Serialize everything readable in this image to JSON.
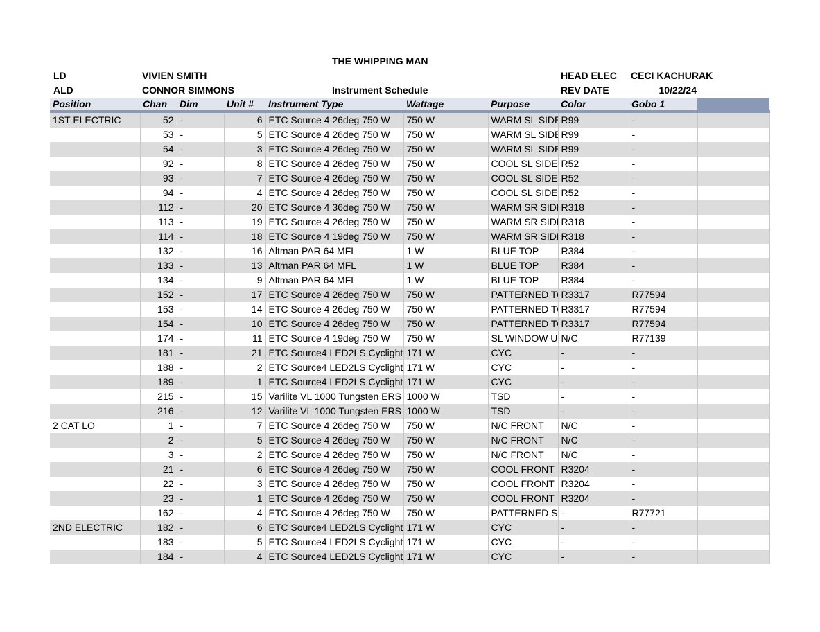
{
  "header": {
    "show_title": "THE WHIPPING MAN",
    "ld_label": "LD",
    "ld_name": "VIVIEN SMITH",
    "ald_label": "ALD",
    "ald_name": "CONNOR SIMMONS",
    "report_title": "Instrument Schedule",
    "head_elec_label": "HEAD ELEC",
    "head_elec_name": "CECI KACHURAK",
    "rev_date_label": "REV DATE",
    "rev_date": "10/22/24"
  },
  "table": {
    "columns": [
      "Position",
      "Chan",
      "Dim",
      "Unit #",
      "Instrument Type",
      "Wattage",
      "Purpose",
      "Color",
      "Gobo 1",
      ""
    ],
    "rows": [
      [
        "1ST ELECTRIC",
        "52",
        "-",
        "6",
        "ETC Source 4 26deg 750 W",
        "750 W",
        "WARM SL SIDE",
        "R99",
        "-",
        ""
      ],
      [
        "",
        "53",
        "-",
        "5",
        "ETC Source 4 26deg 750 W",
        "750 W",
        "WARM SL SIDE",
        "R99",
        "-",
        ""
      ],
      [
        "",
        "54",
        "-",
        "3",
        "ETC Source 4 26deg 750 W",
        "750 W",
        "WARM SL SIDE",
        "R99",
        "-",
        ""
      ],
      [
        "",
        "92",
        "-",
        "8",
        "ETC Source 4 26deg 750 W",
        "750 W",
        "COOL SL SIDE",
        "R52",
        "-",
        ""
      ],
      [
        "",
        "93",
        "-",
        "7",
        "ETC Source 4 26deg 750 W",
        "750 W",
        "COOL SL SIDE",
        "R52",
        "-",
        ""
      ],
      [
        "",
        "94",
        "-",
        "4",
        "ETC Source 4 26deg 750 W",
        "750 W",
        "COOL SL SIDE",
        "R52",
        "-",
        ""
      ],
      [
        "",
        "112",
        "-",
        "20",
        "ETC Source 4 36deg 750 W",
        "750 W",
        "WARM SR SIDE",
        "R318",
        "-",
        ""
      ],
      [
        "",
        "113",
        "-",
        "19",
        "ETC Source 4 26deg 750 W",
        "750 W",
        "WARM SR SIDE",
        "R318",
        "-",
        ""
      ],
      [
        "",
        "114",
        "-",
        "18",
        "ETC Source 4 19deg 750 W",
        "750 W",
        "WARM SR SIDE",
        "R318",
        "-",
        ""
      ],
      [
        "",
        "132",
        "-",
        "16",
        "Altman PAR 64 MFL",
        "1 W",
        "BLUE TOP",
        "R384",
        "-",
        ""
      ],
      [
        "",
        "133",
        "-",
        "13",
        "Altman PAR 64 MFL",
        "1 W",
        "BLUE TOP",
        "R384",
        "-",
        ""
      ],
      [
        "",
        "134",
        "-",
        "9",
        "Altman PAR 64 MFL",
        "1 W",
        "BLUE TOP",
        "R384",
        "-",
        ""
      ],
      [
        "",
        "152",
        "-",
        "17",
        "ETC Source 4 26deg 750 W",
        "750 W",
        "PATTERNED TO",
        "R3317",
        "R77594",
        ""
      ],
      [
        "",
        "153",
        "-",
        "14",
        "ETC Source 4 26deg 750 W",
        "750 W",
        "PATTERNED TO",
        "R3317",
        "R77594",
        ""
      ],
      [
        "",
        "154",
        "-",
        "10",
        "ETC Source 4 26deg 750 W",
        "750 W",
        "PATTERNED TO",
        "R3317",
        "R77594",
        ""
      ],
      [
        "",
        "174",
        "-",
        "11",
        "ETC Source 4 19deg 750 W",
        "750 W",
        "SL WINDOW US",
        "N/C",
        "R77139",
        ""
      ],
      [
        "",
        "181",
        "-",
        "21",
        "ETC Source4 LED2LS Cyclight",
        "171 W",
        "CYC",
        "-",
        "-",
        ""
      ],
      [
        "",
        "188",
        "-",
        "2",
        "ETC Source4 LED2LS Cyclight",
        "171 W",
        "CYC",
        "-",
        "-",
        ""
      ],
      [
        "",
        "189",
        "-",
        "1",
        "ETC Source4 LED2LS Cyclight",
        "171 W",
        "CYC",
        "-",
        "-",
        ""
      ],
      [
        "",
        "215",
        "-",
        "15",
        "Varilite VL 1000 Tungsten ERS",
        "1000 W",
        "TSD",
        "-",
        "-",
        ""
      ],
      [
        "",
        "216",
        "-",
        "12",
        "Varilite VL 1000 Tungsten ERS",
        "1000 W",
        "TSD",
        "-",
        "-",
        ""
      ],
      [
        "2 CAT LO",
        "1",
        "-",
        "7",
        "ETC Source 4 26deg 750 W",
        "750 W",
        "N/C FRONT",
        "N/C",
        "-",
        ""
      ],
      [
        "",
        "2",
        "-",
        "5",
        "ETC Source 4 26deg 750 W",
        "750 W",
        "N/C FRONT",
        "N/C",
        "-",
        ""
      ],
      [
        "",
        "3",
        "-",
        "2",
        "ETC Source 4 26deg 750 W",
        "750 W",
        "N/C FRONT",
        "N/C",
        "-",
        ""
      ],
      [
        "",
        "21",
        "-",
        "6",
        "ETC Source 4 26deg 750 W",
        "750 W",
        "COOL FRONT",
        "R3204",
        "-",
        ""
      ],
      [
        "",
        "22",
        "-",
        "3",
        "ETC Source 4 26deg 750 W",
        "750 W",
        "COOL FRONT",
        "R3204",
        "-",
        ""
      ],
      [
        "",
        "23",
        "-",
        "1",
        "ETC Source 4 26deg 750 W",
        "750 W",
        "COOL FRONT",
        "R3204",
        "-",
        ""
      ],
      [
        "",
        "162",
        "-",
        "4",
        "ETC Source 4 26deg 750 W",
        "750 W",
        "PATTERNED SC",
        "-",
        "R77721",
        ""
      ],
      [
        "2ND ELECTRIC",
        "182",
        "-",
        "6",
        "ETC Source4 LED2LS Cyclight",
        "171 W",
        "CYC",
        "-",
        "-",
        ""
      ],
      [
        "",
        "183",
        "-",
        "5",
        "ETC Source4 LED2LS Cyclight",
        "171 W",
        "CYC",
        "-",
        "-",
        ""
      ],
      [
        "",
        "184",
        "-",
        "4",
        "ETC Source4 LED2LS Cyclight",
        "171 W",
        "CYC",
        "-",
        "-",
        ""
      ]
    ]
  },
  "colors": {
    "header_band": "#dfe4ee",
    "header_accent": "#8a9ab6",
    "row_shade": "#dcdcdc"
  }
}
